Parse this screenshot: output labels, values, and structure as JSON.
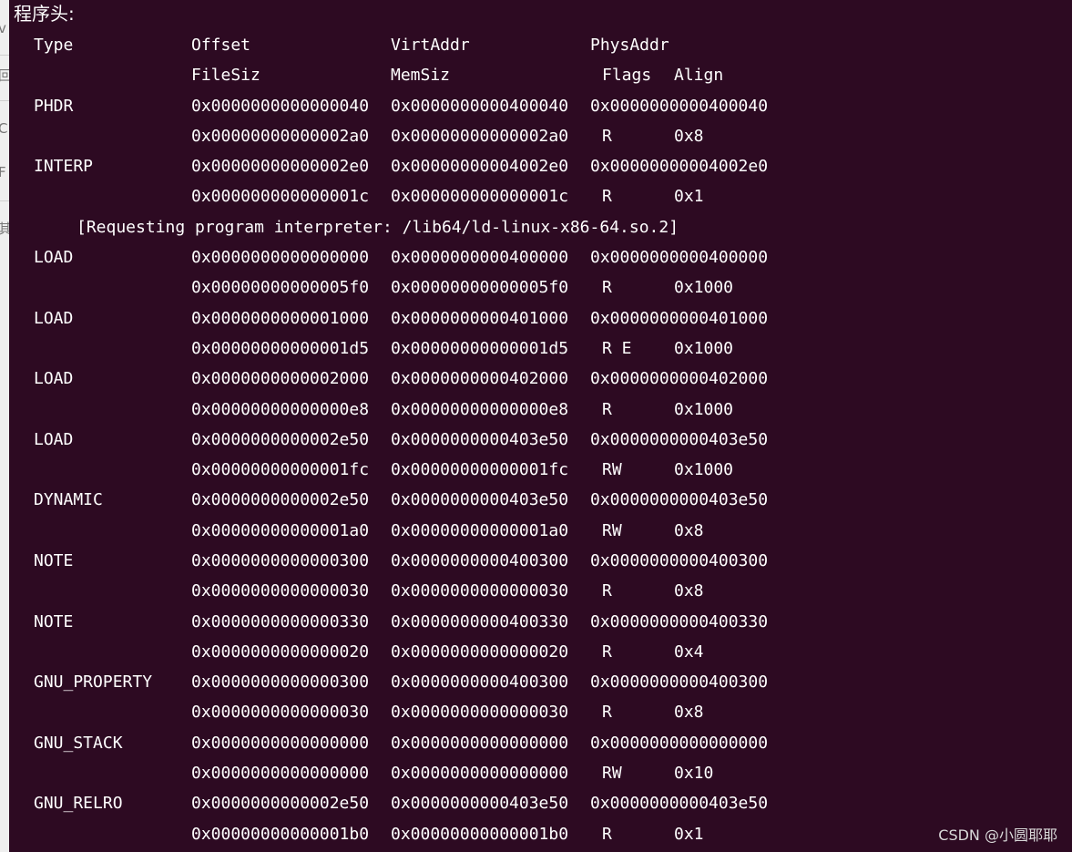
{
  "sidebar_fragments": [
    "v",
    "回",
    "C",
    "F",
    "其"
  ],
  "heading": "程序头:",
  "headers": {
    "type": "Type",
    "offset": "Offset",
    "virtaddr": "VirtAddr",
    "physaddr": "PhysAddr",
    "filesiz": "FileSiz",
    "memsiz": "MemSiz",
    "flags": "Flags",
    "align": "Align"
  },
  "segments": [
    {
      "type": "PHDR",
      "offset": "0x0000000000000040",
      "virt": "0x0000000000400040",
      "phys": "0x0000000000400040",
      "filesiz": "0x00000000000002a0",
      "memsiz": "0x00000000000002a0",
      "flags": "R",
      "align": "0x8"
    },
    {
      "type": "INTERP",
      "offset": "0x00000000000002e0",
      "virt": "0x00000000004002e0",
      "phys": "0x00000000004002e0",
      "filesiz": "0x000000000000001c",
      "memsiz": "0x000000000000001c",
      "flags": "R",
      "align": "0x1",
      "note": "[Requesting program interpreter: /lib64/ld-linux-x86-64.so.2]"
    },
    {
      "type": "LOAD",
      "offset": "0x0000000000000000",
      "virt": "0x0000000000400000",
      "phys": "0x0000000000400000",
      "filesiz": "0x00000000000005f0",
      "memsiz": "0x00000000000005f0",
      "flags": "R",
      "align": "0x1000"
    },
    {
      "type": "LOAD",
      "offset": "0x0000000000001000",
      "virt": "0x0000000000401000",
      "phys": "0x0000000000401000",
      "filesiz": "0x00000000000001d5",
      "memsiz": "0x00000000000001d5",
      "flags": "R E",
      "align": "0x1000"
    },
    {
      "type": "LOAD",
      "offset": "0x0000000000002000",
      "virt": "0x0000000000402000",
      "phys": "0x0000000000402000",
      "filesiz": "0x00000000000000e8",
      "memsiz": "0x00000000000000e8",
      "flags": "R",
      "align": "0x1000"
    },
    {
      "type": "LOAD",
      "offset": "0x0000000000002e50",
      "virt": "0x0000000000403e50",
      "phys": "0x0000000000403e50",
      "filesiz": "0x00000000000001fc",
      "memsiz": "0x00000000000001fc",
      "flags": "RW",
      "align": "0x1000"
    },
    {
      "type": "DYNAMIC",
      "offset": "0x0000000000002e50",
      "virt": "0x0000000000403e50",
      "phys": "0x0000000000403e50",
      "filesiz": "0x00000000000001a0",
      "memsiz": "0x00000000000001a0",
      "flags": "RW",
      "align": "0x8"
    },
    {
      "type": "NOTE",
      "offset": "0x0000000000000300",
      "virt": "0x0000000000400300",
      "phys": "0x0000000000400300",
      "filesiz": "0x0000000000000030",
      "memsiz": "0x0000000000000030",
      "flags": "R",
      "align": "0x8"
    },
    {
      "type": "NOTE",
      "offset": "0x0000000000000330",
      "virt": "0x0000000000400330",
      "phys": "0x0000000000400330",
      "filesiz": "0x0000000000000020",
      "memsiz": "0x0000000000000020",
      "flags": "R",
      "align": "0x4"
    },
    {
      "type": "GNU_PROPERTY",
      "offset": "0x0000000000000300",
      "virt": "0x0000000000400300",
      "phys": "0x0000000000400300",
      "filesiz": "0x0000000000000030",
      "memsiz": "0x0000000000000030",
      "flags": "R",
      "align": "0x8"
    },
    {
      "type": "GNU_STACK",
      "offset": "0x0000000000000000",
      "virt": "0x0000000000000000",
      "phys": "0x0000000000000000",
      "filesiz": "0x0000000000000000",
      "memsiz": "0x0000000000000000",
      "flags": "RW",
      "align": "0x10"
    },
    {
      "type": "GNU_RELRO",
      "offset": "0x0000000000002e50",
      "virt": "0x0000000000403e50",
      "phys": "0x0000000000403e50",
      "filesiz": "0x00000000000001b0",
      "memsiz": "0x00000000000001b0",
      "flags": "R",
      "align": "0x1"
    }
  ],
  "watermark": "CSDN @小圆耶耶",
  "colors": {
    "terminal_bg": "#2d0a22",
    "terminal_fg": "#ffffff",
    "strip_bg": "#efefef"
  }
}
